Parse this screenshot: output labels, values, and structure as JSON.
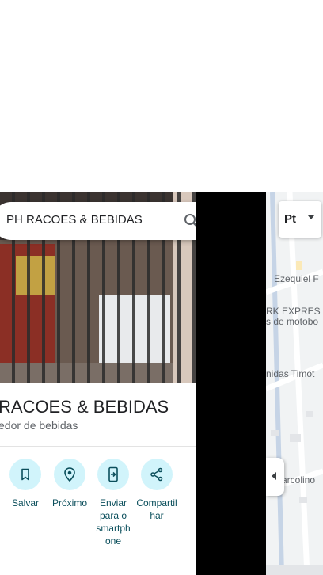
{
  "search": {
    "query": "PH RACOES & BEBIDAS"
  },
  "place": {
    "title": "RACOES & BEBIDAS",
    "category": "edor de bebidas"
  },
  "actions": [
    {
      "label": "Salvar",
      "icon": "bookmark-icon"
    },
    {
      "label": "Próximo",
      "icon": "nearby-icon"
    },
    {
      "label": "Enviar para o smartph one",
      "icon": "send-to-phone-icon"
    },
    {
      "label": "Compartilhar",
      "icon": "share-icon"
    }
  ],
  "map": {
    "layer_label": "Pt",
    "labels": {
      "street1": "Ezequiel F",
      "business1": "RK EXPRES",
      "business2": "s de motobo",
      "street2": "nidas Timót",
      "street3": "arcolino"
    }
  },
  "colors": {
    "action_bg": "#d1f4fb",
    "action_text": "#0b4f5c"
  }
}
